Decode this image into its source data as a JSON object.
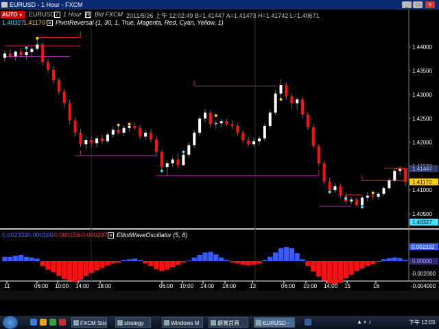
{
  "window": {
    "title": "EURUSD - 1 Hour - FXCM"
  },
  "toolbar": {
    "auto_label": "AUTO",
    "symbol": "EURUSD",
    "interval": "1 Hour",
    "source": "Bid  FXCM",
    "quote": "2011/5/26  上午 12:02:49  B=1.41447  A=1.41473  H=1.41742  L=1.40671"
  },
  "main_indicator": {
    "value1": "1.40327",
    "value2": "1.41170",
    "label": "PivotReversal  (1, 30, 1, True, Magenta, Red, Cyan, Yellow, 1)"
  },
  "osc_indicator": {
    "values": [
      "0.002332",
      "0.000166",
      "-0.000158",
      "-0.000297"
    ],
    "label": "ElliotWaveOscillator  (5, 8)"
  },
  "price_axis": [
    "1.44000",
    "1.43500",
    "1.43000",
    "1.42500",
    "1.42000",
    "1.41500",
    "1.41000",
    "1.40500"
  ],
  "price_tags": {
    "upper": "1.41447",
    "current": "1.41170",
    "lower": "1.40327"
  },
  "osc_axis": [
    "0.002332",
    "0.00000",
    "-0.002000",
    "-0.004000"
  ],
  "osc_tags": {
    "top": "0.002332"
  },
  "time_axis": [
    "11",
    "06:00",
    "10:00",
    "14:00",
    "18:00",
    "06:00",
    "10:00",
    "14:00",
    "18:00",
    "13",
    "06:00",
    "10:00",
    "14:00",
    "15",
    "16"
  ],
  "colors": {
    "bull": "#ffffff",
    "bear": "#ff1010",
    "wick": "#6a7088",
    "pivot_red": "#e02020",
    "pivot_magenta": "#b030b0",
    "osc_pos": "#3a5aff",
    "osc_neg": "#ff1010",
    "cyan": "#40e0ff",
    "yellow": "#ffd000"
  },
  "chart_data": {
    "type": "candlestick",
    "ylim": [
      1.40213,
      1.44609
    ],
    "candles": [
      {
        "o": 1.4377,
        "h": 1.4392,
        "l": 1.4368,
        "c": 1.4386
      },
      {
        "o": 1.4386,
        "h": 1.4395,
        "l": 1.4376,
        "c": 1.438
      },
      {
        "o": 1.438,
        "h": 1.4392,
        "l": 1.4372,
        "c": 1.439
      },
      {
        "o": 1.439,
        "h": 1.4398,
        "l": 1.4377,
        "c": 1.4383
      },
      {
        "o": 1.4383,
        "h": 1.4395,
        "l": 1.4374,
        "c": 1.4389
      },
      {
        "o": 1.4389,
        "h": 1.4401,
        "l": 1.438,
        "c": 1.4396
      },
      {
        "o": 1.4396,
        "h": 1.4418,
        "l": 1.4392,
        "c": 1.4405
      },
      {
        "o": 1.4405,
        "h": 1.441,
        "l": 1.436,
        "c": 1.4368
      },
      {
        "o": 1.4368,
        "h": 1.4375,
        "l": 1.4345,
        "c": 1.4352
      },
      {
        "o": 1.4352,
        "h": 1.436,
        "l": 1.4322,
        "c": 1.433
      },
      {
        "o": 1.433,
        "h": 1.4335,
        "l": 1.43,
        "c": 1.4306
      },
      {
        "o": 1.4306,
        "h": 1.4312,
        "l": 1.4272,
        "c": 1.4282
      },
      {
        "o": 1.4282,
        "h": 1.429,
        "l": 1.4238,
        "c": 1.4246
      },
      {
        "o": 1.4246,
        "h": 1.4252,
        "l": 1.4212,
        "c": 1.422
      },
      {
        "o": 1.422,
        "h": 1.4228,
        "l": 1.419,
        "c": 1.4196
      },
      {
        "o": 1.4196,
        "h": 1.4212,
        "l": 1.4186,
        "c": 1.4205
      },
      {
        "o": 1.4205,
        "h": 1.4213,
        "l": 1.4191,
        "c": 1.4198
      },
      {
        "o": 1.4198,
        "h": 1.4213,
        "l": 1.419,
        "c": 1.4208
      },
      {
        "o": 1.4208,
        "h": 1.4216,
        "l": 1.4196,
        "c": 1.4202
      },
      {
        "o": 1.4202,
        "h": 1.4222,
        "l": 1.4198,
        "c": 1.4216
      },
      {
        "o": 1.4216,
        "h": 1.4232,
        "l": 1.421,
        "c": 1.4226
      },
      {
        "o": 1.4226,
        "h": 1.4234,
        "l": 1.4216,
        "c": 1.422
      },
      {
        "o": 1.422,
        "h": 1.4236,
        "l": 1.4214,
        "c": 1.423
      },
      {
        "o": 1.423,
        "h": 1.4238,
        "l": 1.4222,
        "c": 1.4234
      },
      {
        "o": 1.4234,
        "h": 1.424,
        "l": 1.4226,
        "c": 1.423
      },
      {
        "o": 1.423,
        "h": 1.4236,
        "l": 1.4206,
        "c": 1.4212
      },
      {
        "o": 1.4212,
        "h": 1.4226,
        "l": 1.4205,
        "c": 1.422
      },
      {
        "o": 1.422,
        "h": 1.4228,
        "l": 1.42,
        "c": 1.4206
      },
      {
        "o": 1.4206,
        "h": 1.4214,
        "l": 1.417,
        "c": 1.418
      },
      {
        "o": 1.418,
        "h": 1.4184,
        "l": 1.4142,
        "c": 1.4148
      },
      {
        "o": 1.4148,
        "h": 1.4162,
        "l": 1.413,
        "c": 1.4156
      },
      {
        "o": 1.4156,
        "h": 1.417,
        "l": 1.4148,
        "c": 1.4164
      },
      {
        "o": 1.4164,
        "h": 1.4176,
        "l": 1.4146,
        "c": 1.4152
      },
      {
        "o": 1.4152,
        "h": 1.418,
        "l": 1.415,
        "c": 1.4174
      },
      {
        "o": 1.4174,
        "h": 1.42,
        "l": 1.4168,
        "c": 1.4194
      },
      {
        "o": 1.4194,
        "h": 1.4226,
        "l": 1.4188,
        "c": 1.422
      },
      {
        "o": 1.422,
        "h": 1.4256,
        "l": 1.4214,
        "c": 1.425
      },
      {
        "o": 1.425,
        "h": 1.427,
        "l": 1.4242,
        "c": 1.4262
      },
      {
        "o": 1.4262,
        "h": 1.4268,
        "l": 1.423,
        "c": 1.4238
      },
      {
        "o": 1.4238,
        "h": 1.4246,
        "l": 1.4228,
        "c": 1.424
      },
      {
        "o": 1.424,
        "h": 1.425,
        "l": 1.4232,
        "c": 1.4244
      },
      {
        "o": 1.4244,
        "h": 1.425,
        "l": 1.4234,
        "c": 1.4238
      },
      {
        "o": 1.4238,
        "h": 1.4246,
        "l": 1.4228,
        "c": 1.4234
      },
      {
        "o": 1.4234,
        "h": 1.424,
        "l": 1.4214,
        "c": 1.422
      },
      {
        "o": 1.422,
        "h": 1.4226,
        "l": 1.4198,
        "c": 1.4204
      },
      {
        "o": 1.4204,
        "h": 1.4212,
        "l": 1.419,
        "c": 1.4196
      },
      {
        "o": 1.4196,
        "h": 1.421,
        "l": 1.419,
        "c": 1.4202
      },
      {
        "o": 1.4202,
        "h": 1.4214,
        "l": 1.4194,
        "c": 1.4208
      },
      {
        "o": 1.4208,
        "h": 1.424,
        "l": 1.4202,
        "c": 1.4234
      },
      {
        "o": 1.4234,
        "h": 1.4268,
        "l": 1.4228,
        "c": 1.4262
      },
      {
        "o": 1.4262,
        "h": 1.431,
        "l": 1.4256,
        "c": 1.4302
      },
      {
        "o": 1.4302,
        "h": 1.4332,
        "l": 1.429,
        "c": 1.432
      },
      {
        "o": 1.432,
        "h": 1.4325,
        "l": 1.429,
        "c": 1.4296
      },
      {
        "o": 1.4296,
        "h": 1.4302,
        "l": 1.427,
        "c": 1.4282
      },
      {
        "o": 1.4282,
        "h": 1.4294,
        "l": 1.4268,
        "c": 1.429
      },
      {
        "o": 1.429,
        "h": 1.4296,
        "l": 1.425,
        "c": 1.4258
      },
      {
        "o": 1.4258,
        "h": 1.4264,
        "l": 1.4226,
        "c": 1.4232
      },
      {
        "o": 1.4232,
        "h": 1.4238,
        "l": 1.4186,
        "c": 1.4192
      },
      {
        "o": 1.4192,
        "h": 1.4196,
        "l": 1.415,
        "c": 1.4156
      },
      {
        "o": 1.4156,
        "h": 1.4162,
        "l": 1.4112,
        "c": 1.4118
      },
      {
        "o": 1.4118,
        "h": 1.4126,
        "l": 1.4092,
        "c": 1.41
      },
      {
        "o": 1.41,
        "h": 1.4114,
        "l": 1.4094,
        "c": 1.4108
      },
      {
        "o": 1.4108,
        "h": 1.4114,
        "l": 1.4082,
        "c": 1.4088
      },
      {
        "o": 1.4088,
        "h": 1.4094,
        "l": 1.407,
        "c": 1.4076
      },
      {
        "o": 1.4076,
        "h": 1.4086,
        "l": 1.407,
        "c": 1.408
      },
      {
        "o": 1.408,
        "h": 1.4084,
        "l": 1.4064,
        "c": 1.4068
      },
      {
        "o": 1.4068,
        "h": 1.4088,
        "l": 1.4064,
        "c": 1.4084
      },
      {
        "o": 1.4084,
        "h": 1.4096,
        "l": 1.4076,
        "c": 1.4088
      },
      {
        "o": 1.4088,
        "h": 1.4094,
        "l": 1.408,
        "c": 1.4086
      },
      {
        "o": 1.4086,
        "h": 1.4096,
        "l": 1.408,
        "c": 1.4092
      },
      {
        "o": 1.4092,
        "h": 1.4108,
        "l": 1.4088,
        "c": 1.4104
      },
      {
        "o": 1.4104,
        "h": 1.4124,
        "l": 1.41,
        "c": 1.412
      },
      {
        "o": 1.412,
        "h": 1.4144,
        "l": 1.4116,
        "c": 1.414
      },
      {
        "o": 1.414,
        "h": 1.415,
        "l": 1.4132,
        "c": 1.4144
      },
      {
        "o": 1.4144,
        "h": 1.4146,
        "l": 1.4108,
        "c": 1.4117
      }
    ],
    "oscillator": [
      0.0007,
      0.0007,
      0.0009,
      0.001,
      0.0007,
      0.0006,
      0.0004,
      -0.0008,
      -0.0014,
      -0.0018,
      -0.0024,
      -0.0029,
      -0.0032,
      -0.0034,
      -0.003,
      -0.0024,
      -0.0019,
      -0.0015,
      -0.0011,
      -0.0007,
      -0.0004,
      -0.0002,
      0.0002,
      0.0003,
      0.0004,
      0.0002,
      -0.0004,
      -0.0008,
      -0.0013,
      -0.0016,
      -0.0014,
      -0.001,
      -0.0006,
      -0.0002,
      0.0001,
      0.0006,
      0.001,
      0.0014,
      0.0015,
      0.0011,
      0.0006,
      0.0002,
      -0.0002,
      -0.0004,
      -0.0006,
      -0.0007,
      -0.0006,
      -0.0004,
      0.0002,
      0.0007,
      0.0014,
      0.0021,
      0.0023,
      0.0021,
      0.0013,
      0.0003,
      -0.0008,
      -0.0017,
      -0.0025,
      -0.0031,
      -0.0036,
      -0.0038,
      -0.0035,
      -0.0028,
      -0.0022,
      -0.0016,
      -0.0012,
      -0.0008,
      -0.0005,
      -0.0001,
      0.0003,
      0.0005,
      0.0006,
      0.0005,
      0.0002
    ]
  }
}
